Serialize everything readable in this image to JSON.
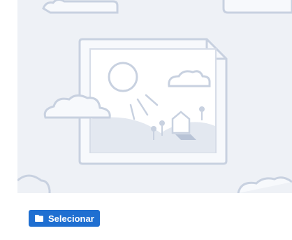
{
  "uploader": {
    "placeholder_icon": "image-placeholder-illustration",
    "select_button": {
      "label": "Selecionar",
      "icon": "folder-icon"
    }
  },
  "colors": {
    "preview_background": "#eef1f6",
    "illustration_stroke": "#c8d1e0",
    "button_background": "#1f6fd1",
    "button_text": "#ffffff"
  }
}
